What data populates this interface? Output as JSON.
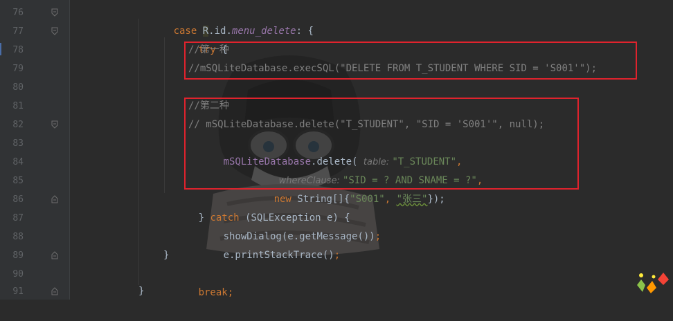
{
  "lines": [
    {
      "num": "76",
      "fold": "start"
    },
    {
      "num": "77",
      "fold": "start"
    },
    {
      "num": "78",
      "fold": ""
    },
    {
      "num": "79",
      "fold": ""
    },
    {
      "num": "80",
      "fold": ""
    },
    {
      "num": "81",
      "fold": ""
    },
    {
      "num": "82",
      "fold": "start"
    },
    {
      "num": "83",
      "fold": ""
    },
    {
      "num": "84",
      "fold": ""
    },
    {
      "num": "85",
      "fold": ""
    },
    {
      "num": "86",
      "fold": "end"
    },
    {
      "num": "87",
      "fold": ""
    },
    {
      "num": "88",
      "fold": ""
    },
    {
      "num": "89",
      "fold": "end"
    },
    {
      "num": "90",
      "fold": ""
    },
    {
      "num": "91",
      "fold": "end"
    }
  ],
  "code": {
    "l76_case": "case ",
    "l76_r": "R",
    "l76_id": ".id.",
    "l76_field": "menu_delete",
    "l76_tail": ": {",
    "l77_try": "try",
    "l77_tail": " {",
    "l78_comment": "//第一种",
    "l79_comment": "//mSQLiteDatabase.execSQL(\"DELETE FROM T_STUDENT WHERE SID = 'S001'\");",
    "l81_comment": "//第二种",
    "l82_comment": "// mSQLiteDatabase.delete(\"T_STUDENT\", \"SID = 'S001'\", null);",
    "l83_field": "mSQLiteDatabase",
    "l83_call": ".delete( ",
    "l83_hint": "table: ",
    "l83_str": "\"T_STUDENT\"",
    "l83_tail": ",",
    "l84_hint": "whereClause: ",
    "l84_str": "\"SID = ? AND SNAME = ?\"",
    "l84_tail": ",",
    "l85_new": "new ",
    "l85_type": "String[]{",
    "l85_str1": "\"S001\"",
    "l85_sep": ", ",
    "l85_str2": "\"张三\"",
    "l85_tail": "});",
    "l86_open": "} ",
    "l86_catch": "catch",
    "l86_tail": " (SQLException e) {",
    "l87_code": "showDialog(e.getMessage())",
    "l87_semi": ";",
    "l88_code": "e.printStackTrace()",
    "l88_semi": ";",
    "l89_code": "}",
    "l90_break": "break",
    "l90_semi": ";",
    "l91_code": "}"
  },
  "colors": {
    "background": "#2b2b2b",
    "keyword": "#cc7832",
    "string": "#6a8759",
    "comment": "#808080",
    "field": "#9876aa",
    "highlight_box": "#e0232d"
  }
}
